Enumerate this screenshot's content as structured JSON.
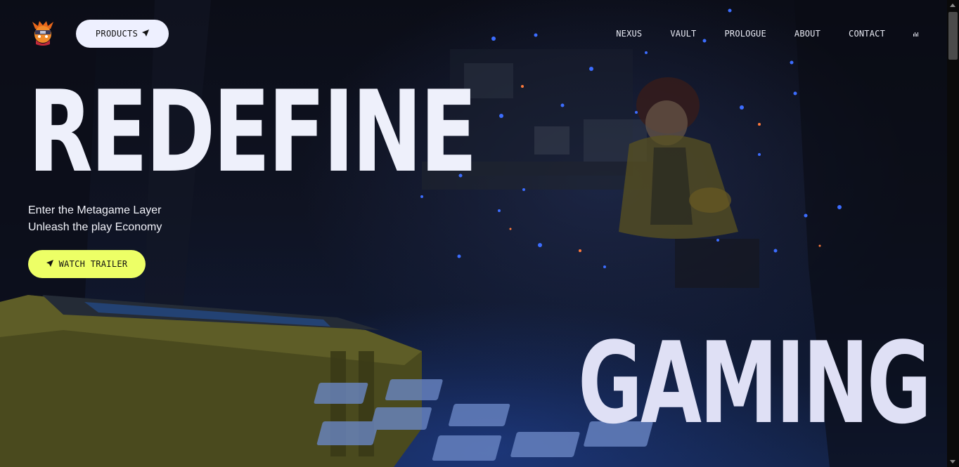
{
  "header": {
    "logo_name": "ninja-avatar-logo",
    "products_label": "PRODUCTS",
    "nav_items": [
      "NEXUS",
      "VAULT",
      "PROLOGUE",
      "ABOUT",
      "CONTACT"
    ]
  },
  "hero": {
    "title": "REDEFINE",
    "subtitle_line1": "Enter the Metagame Layer",
    "subtitle_line2": "Unleash the play Economy",
    "cta_label": "WATCH TRAILER",
    "bottom_title": "GAMING"
  },
  "colors": {
    "accent": "#edff66",
    "button_light": "#eef0ff",
    "text": "#eef0fb",
    "background": "#0b0d17"
  },
  "icons": {
    "products": "send-arrow-icon",
    "trailer": "send-arrow-icon",
    "audio": "audio-bars-icon"
  }
}
